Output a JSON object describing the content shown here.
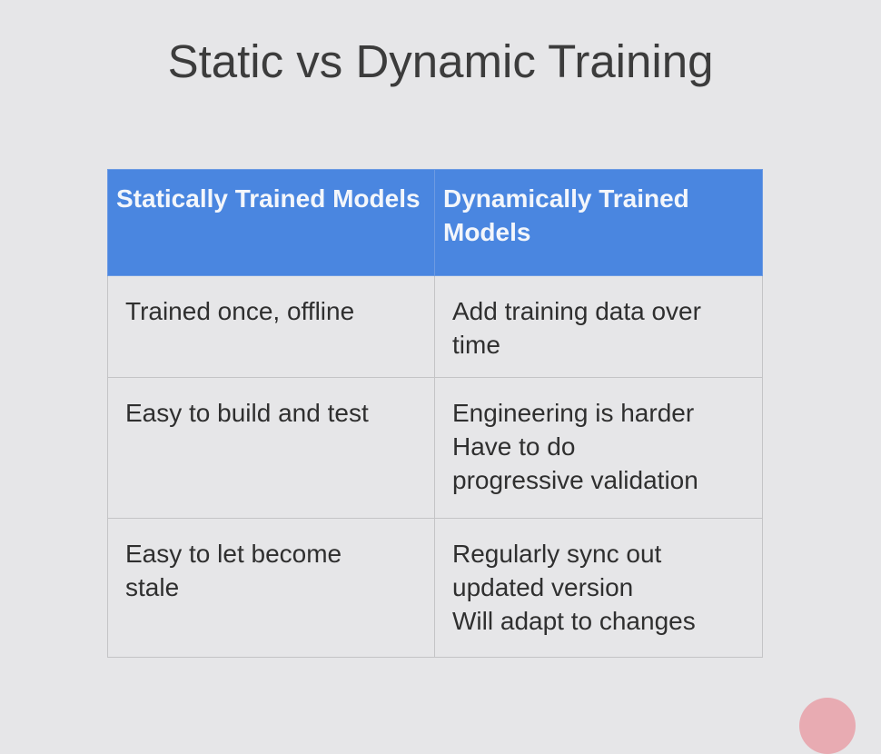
{
  "title": "Static vs Dynamic Training",
  "table": {
    "headers": [
      "Statically Trained Models",
      "Dynamically Trained Models"
    ],
    "rows": [
      [
        "Trained once, offline",
        "Add training data over time"
      ],
      [
        "Easy to build and test",
        "Engineering is harder\nHave to do\nprogressive validation"
      ],
      [
        "Easy to let become\nstale",
        "Regularly sync out\nupdated version\nWill adapt to changes"
      ]
    ]
  },
  "colors": {
    "background": "#e6e6e8",
    "header": "#4a86e0",
    "header_text": "#f3f6fb",
    "body_text": "#2f2f2f",
    "title_text": "#3c3c3c"
  },
  "icons": {
    "corner": "logo-circle-icon"
  }
}
